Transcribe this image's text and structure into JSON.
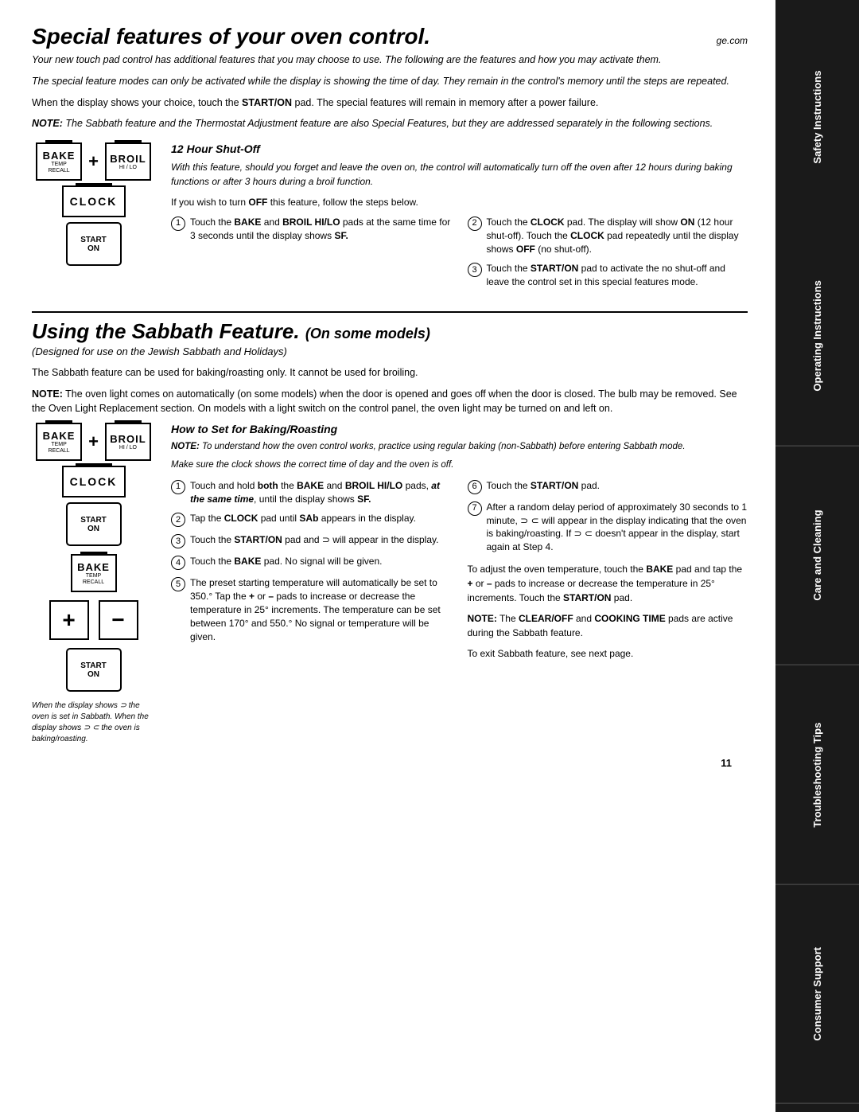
{
  "page": {
    "title": "Special features of your oven control.",
    "site": "ge.com",
    "page_number": "11"
  },
  "intro": {
    "p1": "Your new touch pad control has additional features that you may choose to use. The following are the features and how you may activate them.",
    "p2": "The special feature modes can only be activated while the display is showing the time of day. They remain in the control's memory until the steps are repeated.",
    "p3": "When the display shows your choice, touch the START/ON pad. The special features will remain in memory after a power failure.",
    "p4_note": "NOTE:",
    "p4": " The Sabbath feature and the Thermostat Adjustment feature are also Special Features, but they are addressed separately in the following sections."
  },
  "control_buttons": {
    "bake": "BAKE",
    "bake_sub": "TEMP\nRECALL",
    "broil": "BROIL",
    "broil_sub": "HI / LO",
    "clock": "CLOCK",
    "start": "START",
    "on": "ON"
  },
  "shutoff": {
    "title": "12 Hour Shut-Off",
    "intro": "With this feature, should you forget and leave the oven on, the control will automatically turn off the oven after 12 hours during baking functions or after 3 hours during a broil function.",
    "off_text": "If you wish to turn OFF this feature, follow the steps below.",
    "step1": "Touch the BAKE and BROIL HI/LO pads at the same time for 3 seconds until the display shows SF.",
    "step2": "Touch the CLOCK pad. The display will show ON (12 hour shut-off). Touch the CLOCK pad repeatedly until the display shows OFF (no shut-off).",
    "step3": "Touch the START/ON pad to activate the no shut-off and leave the control set in this special features mode."
  },
  "sabbath": {
    "title": "Using the Sabbath Feature.",
    "title_sub": "(On some models)",
    "subtitle": "(Designed for use on the Jewish Sabbath and Holidays)",
    "note1": "The Sabbath feature can be used for baking/roasting only. It cannot be used for broiling.",
    "note2_label": "NOTE:",
    "note2": " The oven light comes on automatically (on some models) when the door is opened and goes off when the door is closed. The bulb may be removed. See the Oven Light Replacement section. On models with a light switch on the control panel, the oven light may be turned on and left on.",
    "how_to_title": "How to Set for Baking/Roasting",
    "note_how": "NOTE: To understand how the oven control works, practice using regular baking (non-Sabbath) before entering Sabbath mode.",
    "clock_note": "Make sure the clock shows the correct time of day and the oven is off.",
    "step1": "Touch and hold both the BAKE and BROIL HI/LO pads, at the same time, until the display shows SF.",
    "step2": "Tap the CLOCK pad until SAb appears in the display.",
    "step3": "Touch the START/ON pad and ⊃ will appear in the display.",
    "step4": "Touch the BAKE pad. No signal will be given.",
    "step5": "The preset starting temperature will automatically be set to 350.° Tap the + or – pads to increase or decrease the temperature in 25° increments. The temperature can be set between 170° and 550.° No signal or temperature will be given.",
    "step6": "Touch the START/ON pad.",
    "step7": "After a random delay period of approximately 30 seconds to 1 minute, ⊃ ⊂ will appear in the display indicating that the oven is baking/roasting. If ⊃ ⊂ doesn't appear in the display, start again at Step 4.",
    "adjust_text": "To adjust the oven temperature, touch the BAKE pad and tap the + or – pads to increase or decrease the temperature in 25° increments. Touch the START/ON pad.",
    "note3_label": "NOTE:",
    "note3": " The CLEAR/OFF and COOKING TIME pads are active during the Sabbath feature.",
    "exit_text": "To exit Sabbath feature, see next page.",
    "caption": "When the display shows ⊃ the oven is set in Sabbath. When the display shows ⊃ ⊂ the oven is baking/roasting."
  },
  "sidebar": {
    "sections": [
      "Safety Instructions",
      "Operating Instructions",
      "Care and Cleaning",
      "Troubleshooting Tips",
      "Consumer Support"
    ]
  }
}
